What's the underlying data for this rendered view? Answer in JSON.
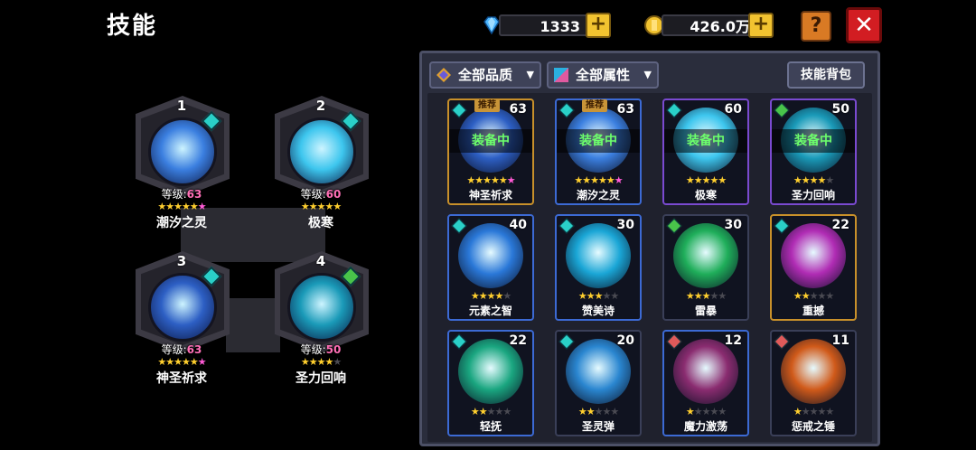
{
  "page": {
    "title": "技能"
  },
  "currencies": [
    {
      "name": "diamonds",
      "value": "1333",
      "icon": "diamond-icon",
      "color": "#4fb8ff"
    },
    {
      "name": "gold",
      "value": "426.0万",
      "icon": "gold-coin-icon",
      "color": "#f2c330"
    }
  ],
  "buttons": {
    "plus": "+",
    "help": "?",
    "close": "✕"
  },
  "equipped": [
    {
      "num": "1",
      "level_label": "等级:",
      "level": "63",
      "stars": 6,
      "name": "潮汐之灵",
      "badge_color": "#2ad0c8",
      "orb": "#3b7fe0"
    },
    {
      "num": "2",
      "level_label": "等级:",
      "level": "60",
      "stars": 5,
      "name": "极寒",
      "badge_color": "#2ad0c8",
      "orb": "#3dc6ee"
    },
    {
      "num": "3",
      "level_label": "等级:",
      "level": "63",
      "stars": 6,
      "name": "神圣祈求",
      "badge_color": "#2ad0c8",
      "orb": "#2d5fc4"
    },
    {
      "num": "4",
      "level_label": "等级:",
      "level": "50",
      "stars": 4,
      "name": "圣力回响",
      "badge_color": "#49c44a",
      "orb": "#1a9ab8"
    }
  ],
  "panel": {
    "filters": [
      {
        "label": "全部品质",
        "icon": "quality-filter-icon"
      },
      {
        "label": "全部属性",
        "icon": "attribute-filter-icon"
      }
    ],
    "bag_button": "技能背包",
    "cards": [
      {
        "name": "神圣祈求",
        "level": "63",
        "stars": 6,
        "equipped": "装备中",
        "recommended": "推荐",
        "frame": "gold",
        "orb": "#2d5fc4",
        "gem": "#2ad0c8"
      },
      {
        "name": "潮汐之灵",
        "level": "63",
        "stars": 6,
        "equipped": "装备中",
        "recommended": "推荐",
        "frame": "blue",
        "orb": "#3b7fe0",
        "gem": "#2ad0c8"
      },
      {
        "name": "极寒",
        "level": "60",
        "stars": 5,
        "equipped": "装备中",
        "recommended": "",
        "frame": "purple",
        "orb": "#3dc6ee",
        "gem": "#2ad0c8"
      },
      {
        "name": "圣力回响",
        "level": "50",
        "stars": 4,
        "equipped": "装备中",
        "recommended": "",
        "frame": "purple",
        "orb": "#1a9ab8",
        "gem": "#49c44a"
      },
      {
        "name": "元素之智",
        "level": "40",
        "stars": 4,
        "equipped": "",
        "recommended": "",
        "frame": "blue",
        "orb": "#2a78d8",
        "gem": "#2ad0c8"
      },
      {
        "name": "赞美诗",
        "level": "30",
        "stars": 3,
        "equipped": "",
        "recommended": "",
        "frame": "blue",
        "orb": "#1aa6d6",
        "gem": "#2ad0c8"
      },
      {
        "name": "雷暴",
        "level": "30",
        "stars": 3,
        "equipped": "",
        "recommended": "",
        "frame": "plain",
        "orb": "#1fae5a",
        "gem": "#49c44a"
      },
      {
        "name": "重撼",
        "level": "22",
        "stars": 2,
        "equipped": "",
        "recommended": "",
        "frame": "gold",
        "orb": "#b02cb4",
        "gem": "#2ad0c8"
      },
      {
        "name": "轻抚",
        "level": "22",
        "stars": 2,
        "equipped": "",
        "recommended": "",
        "frame": "blue",
        "orb": "#1aa680",
        "gem": "#2ad0c8"
      },
      {
        "name": "圣灵弹",
        "level": "20",
        "stars": 2,
        "equipped": "",
        "recommended": "",
        "frame": "plain",
        "orb": "#2a86d0",
        "gem": "#2ad0c8"
      },
      {
        "name": "魔力激荡",
        "level": "12",
        "stars": 1,
        "equipped": "",
        "recommended": "",
        "frame": "blue",
        "orb": "#8a2c70",
        "gem": "#e05a5a"
      },
      {
        "name": "惩戒之锤",
        "level": "11",
        "stars": 1,
        "equipped": "",
        "recommended": "",
        "frame": "plain",
        "orb": "#d05a1a",
        "gem": "#e05a5a"
      }
    ]
  }
}
